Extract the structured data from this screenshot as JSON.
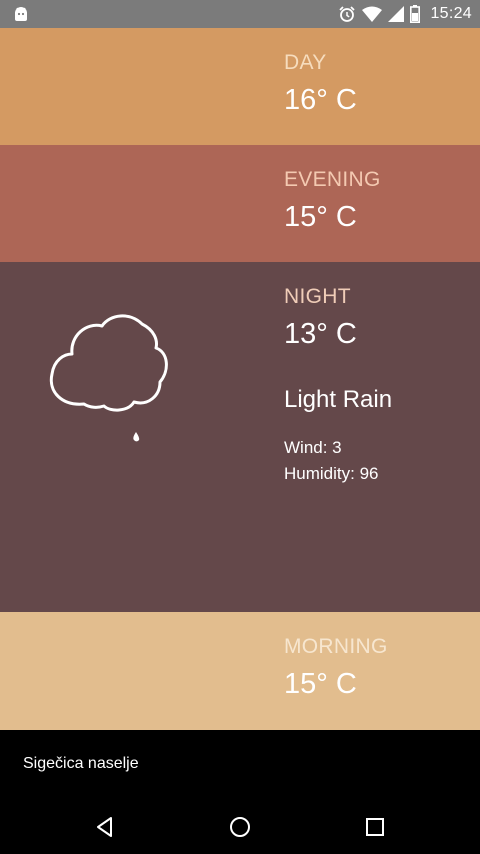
{
  "status_bar": {
    "time": "15:24",
    "icons": [
      "android-app-icon",
      "alarm-icon",
      "wifi-icon",
      "signal-icon",
      "battery-icon"
    ]
  },
  "periods": {
    "day": {
      "label": "DAY",
      "temperature": "16° C"
    },
    "evening": {
      "label": "EVENING",
      "temperature": "15° C"
    },
    "night": {
      "label": "NIGHT",
      "temperature": "13° C",
      "condition": "Light Rain",
      "wind": "Wind: 3",
      "humidity": "Humidity: 96",
      "icon": "rain-cloud-icon"
    },
    "morning": {
      "label": "MORNING",
      "temperature": "15° C"
    }
  },
  "location": "Sigečica naselje",
  "nav_bar": {
    "icons": [
      "back-icon",
      "home-icon",
      "recents-icon"
    ]
  },
  "colors": {
    "status_bar": "#7b7b7b",
    "day": "#d49a62",
    "evening": "#ad6656",
    "night": "#64484a",
    "morning": "#e2bd8e",
    "bottom": "#000000"
  }
}
